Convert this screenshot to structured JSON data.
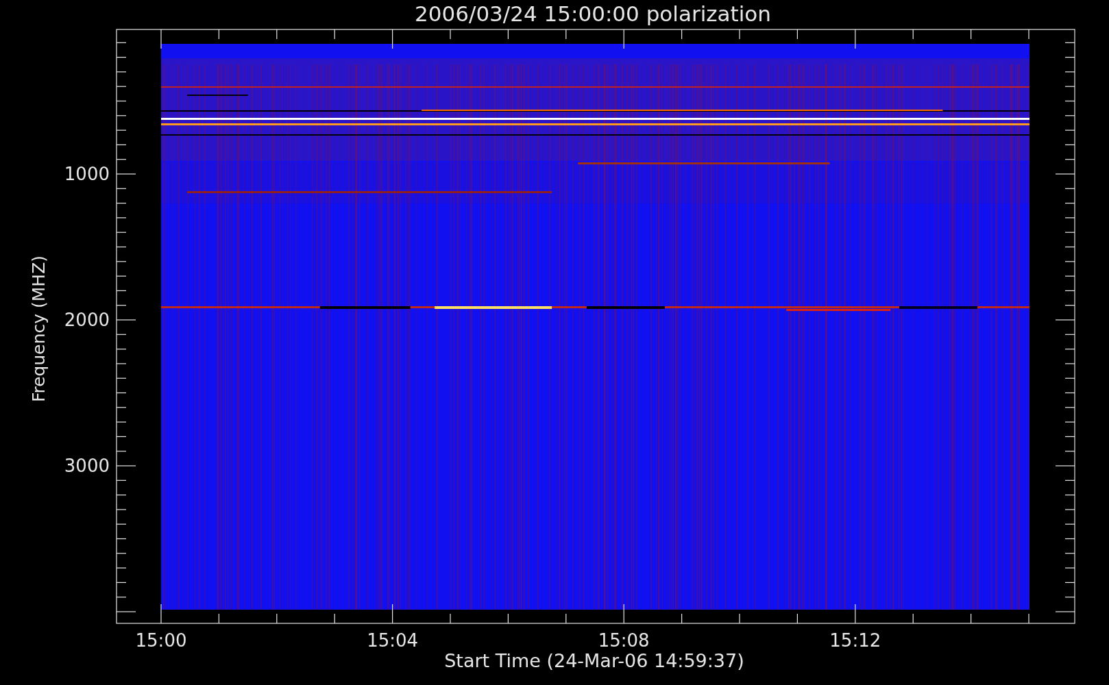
{
  "title": "2006/03/24 15:00:00 polarization",
  "y_axis": {
    "label": "Frequency (MHZ)",
    "ticks": [
      "1000",
      "2000",
      "3000"
    ]
  },
  "x_axis": {
    "label": "Start Time (24-Mar-06 14:59:37)",
    "ticks": [
      "15:00",
      "15:04",
      "15:08",
      "15:12"
    ]
  }
}
